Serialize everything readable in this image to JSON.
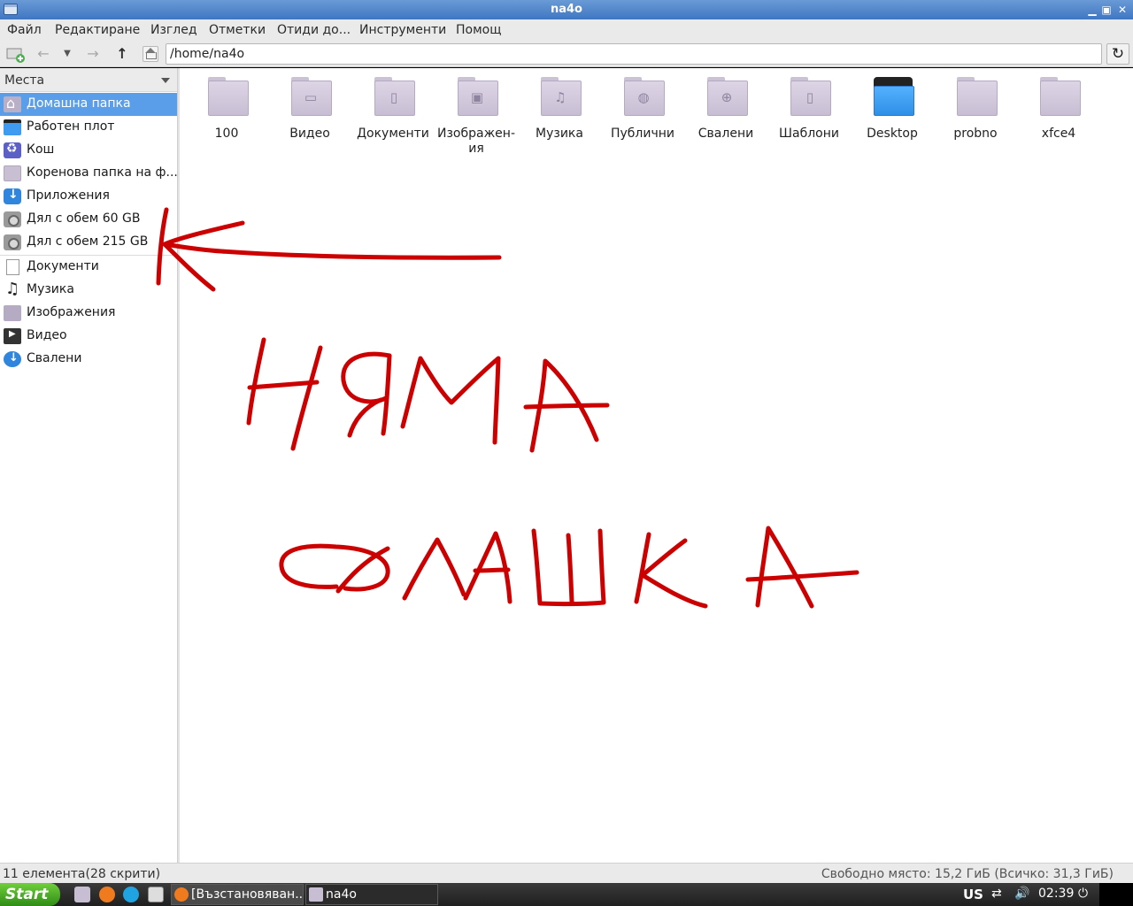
{
  "window": {
    "title": "na4o"
  },
  "menu": [
    "Файл",
    "Редактиране",
    "Изглед",
    "Отметки",
    "Отиди до...",
    "Инструменти",
    "Помощ"
  ],
  "location": {
    "path": "/home/na4o"
  },
  "sidebar": {
    "header": "Места",
    "items": [
      {
        "label": "Домашна папка",
        "icon": "home-folder-icon"
      },
      {
        "label": "Работен плот",
        "icon": "desktop-icon"
      },
      {
        "label": "Кош",
        "icon": "trash-icon"
      },
      {
        "label": "Коренова папка на ф...",
        "icon": "folder-icon"
      },
      {
        "label": "Приложения",
        "icon": "applications-icon"
      },
      {
        "label": "Дял с обем 60 GB",
        "icon": "disk-icon"
      },
      {
        "label": "Дял с обем 215 GB",
        "icon": "disk-icon"
      },
      {
        "label": "Документи",
        "icon": "document-icon"
      },
      {
        "label": "Музика",
        "icon": "music-icon"
      },
      {
        "label": "Изображения",
        "icon": "pictures-icon"
      },
      {
        "label": "Видео",
        "icon": "video-icon"
      },
      {
        "label": "Свалени",
        "icon": "downloads-icon"
      }
    ]
  },
  "files": [
    {
      "name": "100",
      "icon": "folder-icon",
      "glyph": ""
    },
    {
      "name": "Видео",
      "icon": "video-folder-icon",
      "glyph": "▭"
    },
    {
      "name": "Документи",
      "icon": "documents-folder-icon",
      "glyph": "▯"
    },
    {
      "name": "Изображен-ия",
      "icon": "pictures-folder-icon",
      "glyph": "▣"
    },
    {
      "name": "Музика",
      "icon": "music-folder-icon",
      "glyph": "♫"
    },
    {
      "name": "Публични",
      "icon": "public-folder-icon",
      "glyph": "◍"
    },
    {
      "name": "Свалени",
      "icon": "downloads-folder-icon",
      "glyph": "⊕"
    },
    {
      "name": "Шаблони",
      "icon": "templates-folder-icon",
      "glyph": "▯"
    },
    {
      "name": "Desktop",
      "icon": "desktop-folder-icon",
      "glyph": ""
    },
    {
      "name": "probno",
      "icon": "folder-icon",
      "glyph": ""
    },
    {
      "name": "xfce4",
      "icon": "folder-icon",
      "glyph": ""
    }
  ],
  "annotation": {
    "line1": "НЯМА",
    "line2": "ФЛАШКА",
    "color": "#cc0000"
  },
  "status": {
    "left": "11 елемента(28 скрити)",
    "right": "Свободно място: 15,2 ГиБ (Всичко: 31,3 ГиБ)"
  },
  "taskbar": {
    "start": "Start",
    "tasks": [
      "[Възстановяван...",
      "na4o"
    ],
    "keyboard": "US",
    "clock": "02:39"
  }
}
